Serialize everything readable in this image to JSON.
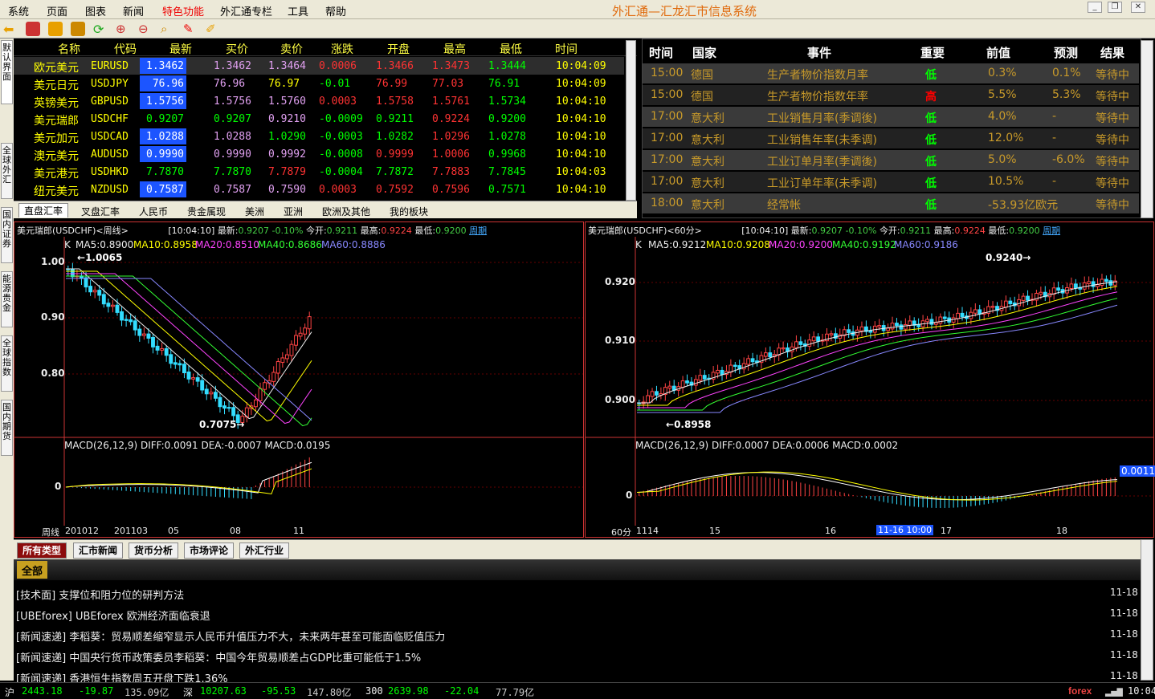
{
  "menu": [
    "系统",
    "页面",
    "图表",
    "新闻",
    "特色功能",
    "外汇通专栏",
    "工具",
    "帮助"
  ],
  "app_title": "外汇通—汇龙汇市信息系统",
  "left_tabs": [
    "默认界面",
    "全球外汇",
    "国内证券",
    "能源贵金",
    "全球指数",
    "国内期货"
  ],
  "quotes": {
    "headers": [
      "名称",
      "代码",
      "最新",
      "买价",
      "卖价",
      "涨跌",
      "开盘",
      "最高",
      "最低",
      "时间"
    ],
    "rows": [
      {
        "name": "欧元美元",
        "code": "EURUSD",
        "last": "1.3462",
        "bid": "1.3462",
        "ask": "1.3464",
        "chg": "0.0006",
        "open": "1.3466",
        "high": "1.3473",
        "low": "1.3444",
        "time": "10:04:09",
        "bidc": "#e0a0f0",
        "askc": "#e0a0f0",
        "chgc": "#f33",
        "openc": "#f33",
        "highc": "#f33",
        "lowc": "#0f0",
        "last_hl": true
      },
      {
        "name": "美元日元",
        "code": "USDJPY",
        "last": "76.96",
        "bid": "76.96",
        "ask": "76.97",
        "chg": "-0.01",
        "open": "76.99",
        "high": "77.03",
        "low": "76.91",
        "time": "10:04:09",
        "bidc": "#e0a0f0",
        "askc": "#ff0",
        "chgc": "#0f0",
        "openc": "#f33",
        "highc": "#f33",
        "lowc": "#0f0",
        "last_hl": true
      },
      {
        "name": "英镑美元",
        "code": "GBPUSD",
        "last": "1.5756",
        "bid": "1.5756",
        "ask": "1.5760",
        "chg": "0.0003",
        "open": "1.5758",
        "high": "1.5761",
        "low": "1.5734",
        "time": "10:04:10",
        "bidc": "#e0a0f0",
        "askc": "#e0a0f0",
        "chgc": "#f33",
        "openc": "#f33",
        "highc": "#f33",
        "lowc": "#0f0",
        "last_hl": true
      },
      {
        "name": "美元瑞郎",
        "code": "USDCHF",
        "last": "0.9207",
        "bid": "0.9207",
        "ask": "0.9210",
        "chg": "-0.0009",
        "open": "0.9211",
        "high": "0.9224",
        "low": "0.9200",
        "time": "10:04:10",
        "bidc": "#0f0",
        "askc": "#e0a0f0",
        "chgc": "#0f0",
        "openc": "#0f0",
        "highc": "#f33",
        "lowc": "#0f0",
        "last_hl": false
      },
      {
        "name": "美元加元",
        "code": "USDCAD",
        "last": "1.0288",
        "bid": "1.0288",
        "ask": "1.0290",
        "chg": "-0.0003",
        "open": "1.0282",
        "high": "1.0296",
        "low": "1.0278",
        "time": "10:04:10",
        "bidc": "#e0a0f0",
        "askc": "#0f0",
        "chgc": "#0f0",
        "openc": "#0f0",
        "highc": "#f33",
        "lowc": "#0f0",
        "last_hl": true
      },
      {
        "name": "澳元美元",
        "code": "AUDUSD",
        "last": "0.9990",
        "bid": "0.9990",
        "ask": "0.9992",
        "chg": "-0.0008",
        "open": "0.9999",
        "high": "1.0006",
        "low": "0.9968",
        "time": "10:04:10",
        "bidc": "#e0a0f0",
        "askc": "#e0a0f0",
        "chgc": "#0f0",
        "openc": "#f33",
        "highc": "#f33",
        "lowc": "#0f0",
        "last_hl": true
      },
      {
        "name": "美元港元",
        "code": "USDHKD",
        "last": "7.7870",
        "bid": "7.7870",
        "ask": "7.7879",
        "chg": "-0.0004",
        "open": "7.7872",
        "high": "7.7883",
        "low": "7.7845",
        "time": "10:04:03",
        "bidc": "#0f0",
        "askc": "#f33",
        "chgc": "#0f0",
        "openc": "#0f0",
        "highc": "#f33",
        "lowc": "#0f0",
        "last_hl": false
      },
      {
        "name": "纽元美元",
        "code": "NZDUSD",
        "last": "0.7587",
        "bid": "0.7587",
        "ask": "0.7590",
        "chg": "0.0003",
        "open": "0.7592",
        "high": "0.7596",
        "low": "0.7571",
        "time": "10:04:10",
        "bidc": "#e0a0f0",
        "askc": "#e0a0f0",
        "chgc": "#f33",
        "openc": "#f33",
        "highc": "#f33",
        "lowc": "#0f0",
        "last_hl": true
      }
    ],
    "tabs": [
      "直盘汇率",
      "叉盘汇率",
      "人民币",
      "贵金属现",
      "美洲",
      "亚洲",
      "欧洲及其他",
      "我的板块"
    ]
  },
  "events": {
    "headers": [
      "时间",
      "国家",
      "事件",
      "重要",
      "前值",
      "预测",
      "结果"
    ],
    "rows": [
      {
        "time": "15:00",
        "country": "德国",
        "event": "生产者物价指数月率",
        "imp": "低",
        "prev": "0.3%",
        "fc": "0.1%",
        "res": "等待中",
        "hi": false
      },
      {
        "time": "15:00",
        "country": "德国",
        "event": "生产者物价指数年率",
        "imp": "高",
        "prev": "5.5%",
        "fc": "5.3%",
        "res": "等待中",
        "hi": true
      },
      {
        "time": "17:00",
        "country": "意大利",
        "event": "工业销售月率(季调後)",
        "imp": "低",
        "prev": "4.0%",
        "fc": "-",
        "res": "等待中",
        "hi": false
      },
      {
        "time": "17:00",
        "country": "意大利",
        "event": "工业销售年率(未季调)",
        "imp": "低",
        "prev": "12.0%",
        "fc": "-",
        "res": "等待中",
        "hi": false
      },
      {
        "time": "17:00",
        "country": "意大利",
        "event": "工业订单月率(季调後)",
        "imp": "低",
        "prev": "5.0%",
        "fc": "-6.0%",
        "res": "等待中",
        "hi": false
      },
      {
        "time": "17:00",
        "country": "意大利",
        "event": "工业订单年率(未季调)",
        "imp": "低",
        "prev": "10.5%",
        "fc": "-",
        "res": "等待中",
        "hi": false
      },
      {
        "time": "18:00",
        "country": "意大利",
        "event": "经常帐",
        "imp": "低",
        "prev": "-53.93亿欧元",
        "fc": "-",
        "res": "等待中",
        "hi": false
      }
    ]
  },
  "chart_left": {
    "title": "美元瑞郎(USDCHF)<周线>",
    "time": "[10:04:10]",
    "latest_label": "最新:",
    "latest": "0.9207",
    "pct": "-0.10%",
    "open_label": "今开:",
    "open": "0.9211",
    "high_label": "最高:",
    "high": "0.9224",
    "low_label": "最低:",
    "low": "0.9200",
    "period": "周期",
    "k": "K",
    "ma5": "MA5:0.8900",
    "ma10": "MA10:0.8958",
    "ma20": "MA20:0.8510",
    "ma40": "MA40:0.8686",
    "ma60": "MA60:0.8886",
    "y_ticks": [
      "1.00",
      "0.90",
      "0.80"
    ],
    "hi_ann": "1.0065",
    "lo_ann": "0.7075",
    "macd": "MACD(26,12,9) DIFF:0.0091 DEA:-0.0007 MACD:0.0195",
    "macd_zero": "0",
    "x_period": "周线",
    "x_ticks": [
      "201012",
      "201103",
      "05",
      "08",
      "11"
    ]
  },
  "chart_right": {
    "title": "美元瑞郎(USDCHF)<60分>",
    "time": "[10:04:10]",
    "latest_label": "最新:",
    "latest": "0.9207",
    "pct": "-0.10%",
    "open_label": "今开:",
    "open": "0.9211",
    "high_label": "最高:",
    "high": "0.9224",
    "low_label": "最低:",
    "low": "0.9200",
    "period": "周期",
    "k": "K",
    "ma5": "MA5:0.9212",
    "ma10": "MA10:0.9208",
    "ma20": "MA20:0.9200",
    "ma40": "MA40:0.9192",
    "ma60": "MA60:0.9186",
    "y_ticks": [
      "0.920",
      "0.910",
      "0.900"
    ],
    "hi_ann": "0.9240",
    "lo_ann": "0.8958",
    "macd": "MACD(26,12,9) DIFF:0.0007 DEA:0.0006 MACD:0.0002",
    "macd_zero": "0",
    "macd_cur": "0.0011",
    "x_period": "60分",
    "x_ticks": [
      "1114",
      "15",
      "16",
      "17",
      "18"
    ],
    "cursor_time": "11-16 10:00"
  },
  "news": {
    "tabs": [
      "所有类型",
      "汇市新闻",
      "货币分析",
      "市场评论",
      "外汇行业"
    ],
    "sub": "全部",
    "items": [
      {
        "t": "[技术面] 支撑位和阻力位的研判方法",
        "d": "11-18"
      },
      {
        "t": "[UBEforex] UBEforex 欧洲经济面临衰退",
        "d": "11-18"
      },
      {
        "t": "[新闻速递] 李稻葵：贸易顺差缩窄显示人民币升值压力不大，未来两年甚至可能面临贬值压力",
        "d": "11-18"
      },
      {
        "t": "[新闻速递] 中国央行货币政策委员李稻葵：中国今年贸易顺差占GDP比重可能低于1.5%",
        "d": "11-18"
      },
      {
        "t": "[新闻速递] 香港恒生指数周五开盘下跌1.36%",
        "d": "11-18"
      }
    ]
  },
  "status": {
    "sh": "沪",
    "sh_v": "2443.18",
    "sh_c": "-19.87",
    "sh_a": "135.09亿",
    "sz": "深",
    "sz_v": "10207.63",
    "sz_c": "-95.53",
    "sz_a": "147.80亿",
    "hs": "300",
    "hs_v": "2639.98",
    "hs_c": "-22.04",
    "hs_a": "77.79亿",
    "brand": "forex",
    "clock": "10:04"
  }
}
